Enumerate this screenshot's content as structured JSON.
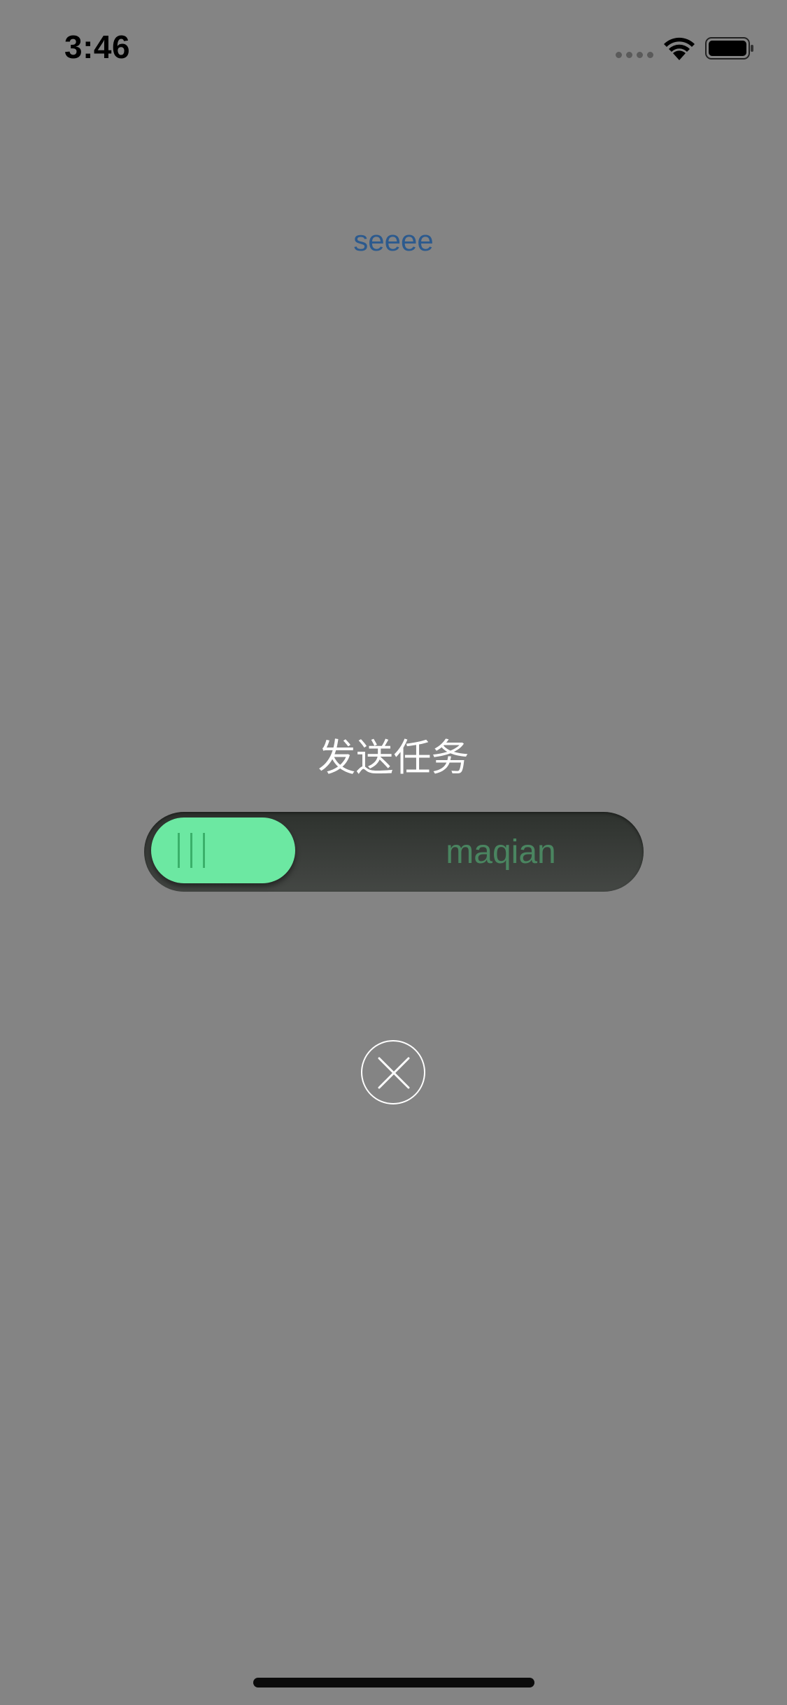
{
  "status_bar": {
    "time": "3:46",
    "icons": [
      "signal-dots-icon",
      "wifi-icon",
      "battery-icon"
    ]
  },
  "top_label": "seeee",
  "title": "发送任务",
  "slider": {
    "label": "maqian",
    "knob_color": "#6ce8a2",
    "label_color": "#4a8560",
    "position": 0
  },
  "close_button": {
    "icon": "close-icon"
  },
  "colors": {
    "background": "#848484",
    "top_label": "#2c5a8e",
    "title": "#ffffff"
  }
}
